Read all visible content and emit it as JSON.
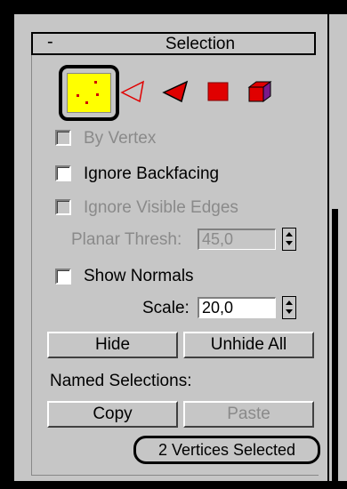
{
  "rollout": {
    "toggle": "-",
    "title": "Selection"
  },
  "subobject_icons": [
    {
      "name": "vertex-icon",
      "selected": true
    },
    {
      "name": "edge-icon",
      "selected": false
    },
    {
      "name": "face-icon",
      "selected": false
    },
    {
      "name": "polygon-icon",
      "selected": false
    },
    {
      "name": "element-icon",
      "selected": false
    }
  ],
  "options": {
    "by_vertex": {
      "label": "By Vertex",
      "checked": false,
      "enabled": false
    },
    "ignore_backfacing": {
      "label": "Ignore Backfacing",
      "checked": false,
      "enabled": true
    },
    "ignore_visible_edges": {
      "label": "Ignore Visible Edges",
      "checked": false,
      "enabled": false
    },
    "planar_thresh": {
      "label": "Planar Thresh:",
      "value": "45,0",
      "enabled": false
    },
    "show_normals": {
      "label": "Show Normals",
      "checked": false,
      "enabled": true
    },
    "scale": {
      "label": "Scale:",
      "value": "20,0",
      "enabled": true
    }
  },
  "buttons": {
    "hide": "Hide",
    "unhide_all": "Unhide All",
    "copy": "Copy",
    "paste": "Paste"
  },
  "named_selections_label": "Named Selections:",
  "status": "2 Vertices Selected",
  "colors": {
    "panel": "#c6c6c6",
    "vertex_bg": "#ffff00",
    "icon_red": "#e00000",
    "element_purple": "#7a1a8a",
    "disabled_text": "#8a8a8a"
  }
}
